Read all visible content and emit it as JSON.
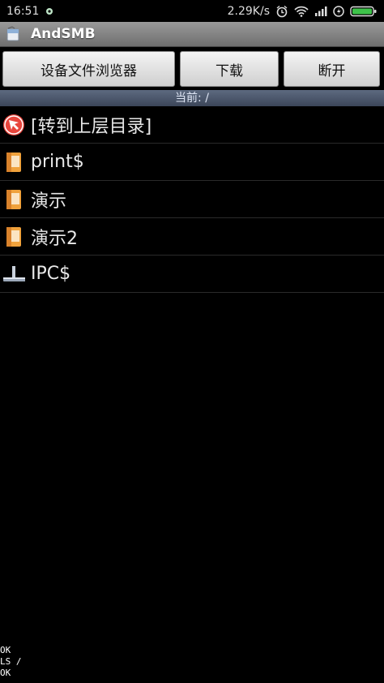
{
  "status_bar": {
    "time": "16:51",
    "net_speed": "2.29K/s",
    "icons": [
      "notification-dot-icon",
      "alarm-icon",
      "wifi-icon",
      "signal-icon",
      "charging-icon",
      "battery-icon"
    ]
  },
  "app_bar": {
    "title": "AndSMB",
    "icon": "app-icon"
  },
  "toolbar": {
    "browser_label": "设备文件浏览器",
    "download_label": "下载",
    "disconnect_label": "断开"
  },
  "path": {
    "current": "当前: /"
  },
  "items": [
    {
      "label": "[转到上层目录]",
      "icon": "up-directory-icon"
    },
    {
      "label": "print$",
      "icon": "folder-share-icon"
    },
    {
      "label": "演示",
      "icon": "folder-share-icon"
    },
    {
      "label": "演示2",
      "icon": "folder-share-icon"
    },
    {
      "label": "IPC$",
      "icon": "ipc-share-icon"
    }
  ],
  "log": [
    "OK",
    "LS /",
    "OK"
  ],
  "colors": {
    "path_bar": "#4a5569",
    "background": "#000000",
    "title_bar": "#8a8a8a"
  }
}
